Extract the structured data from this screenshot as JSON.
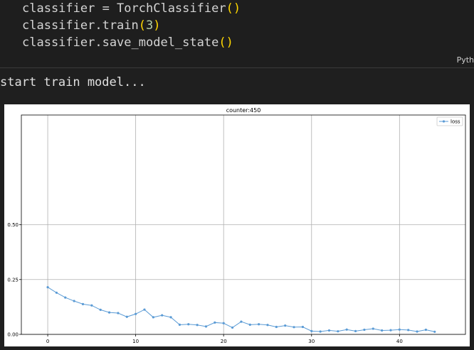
{
  "code": {
    "lines": [
      {
        "pre": "classifier = TorchClassifier",
        "arg": "",
        "open": "(",
        "close": ")"
      },
      {
        "pre": "classifier.train",
        "arg": "3",
        "open": "(",
        "close": ")"
      },
      {
        "pre": "classifier.save_model_state",
        "arg": "",
        "open": "(",
        "close": ")"
      }
    ],
    "language": "Pyth"
  },
  "output": {
    "text": "start train model..."
  },
  "chart_data": {
    "type": "line",
    "title": "counter:450",
    "xlabel": "",
    "ylabel": "",
    "xlim": [
      -3,
      47.5
    ],
    "ylim": [
      0,
      1.0
    ],
    "xticks": [
      0,
      10,
      20,
      30,
      40
    ],
    "yticks": [
      0.0,
      0.25,
      0.5
    ],
    "ytick_labels": [
      "0.00",
      "0.25",
      "0.50"
    ],
    "grid": true,
    "legend": "top-right",
    "colors": {
      "series": "#5b9bd5"
    },
    "series": [
      {
        "name": "loss",
        "x": [
          0,
          1,
          2,
          3,
          4,
          5,
          6,
          7,
          8,
          9,
          10,
          11,
          12,
          13,
          14,
          15,
          16,
          17,
          18,
          19,
          20,
          21,
          22,
          23,
          24,
          25,
          26,
          27,
          28,
          29,
          30,
          31,
          32,
          33,
          34,
          35,
          36,
          37,
          38,
          39,
          40,
          41,
          42,
          43,
          44
        ],
        "values": [
          0.215,
          0.19,
          0.168,
          0.152,
          0.138,
          0.132,
          0.112,
          0.1,
          0.097,
          0.08,
          0.093,
          0.113,
          0.078,
          0.087,
          0.078,
          0.044,
          0.046,
          0.043,
          0.036,
          0.054,
          0.051,
          0.031,
          0.058,
          0.044,
          0.046,
          0.043,
          0.034,
          0.04,
          0.033,
          0.034,
          0.015,
          0.013,
          0.018,
          0.014,
          0.022,
          0.015,
          0.021,
          0.026,
          0.018,
          0.019,
          0.022,
          0.02,
          0.013,
          0.021,
          0.012
        ]
      }
    ]
  }
}
